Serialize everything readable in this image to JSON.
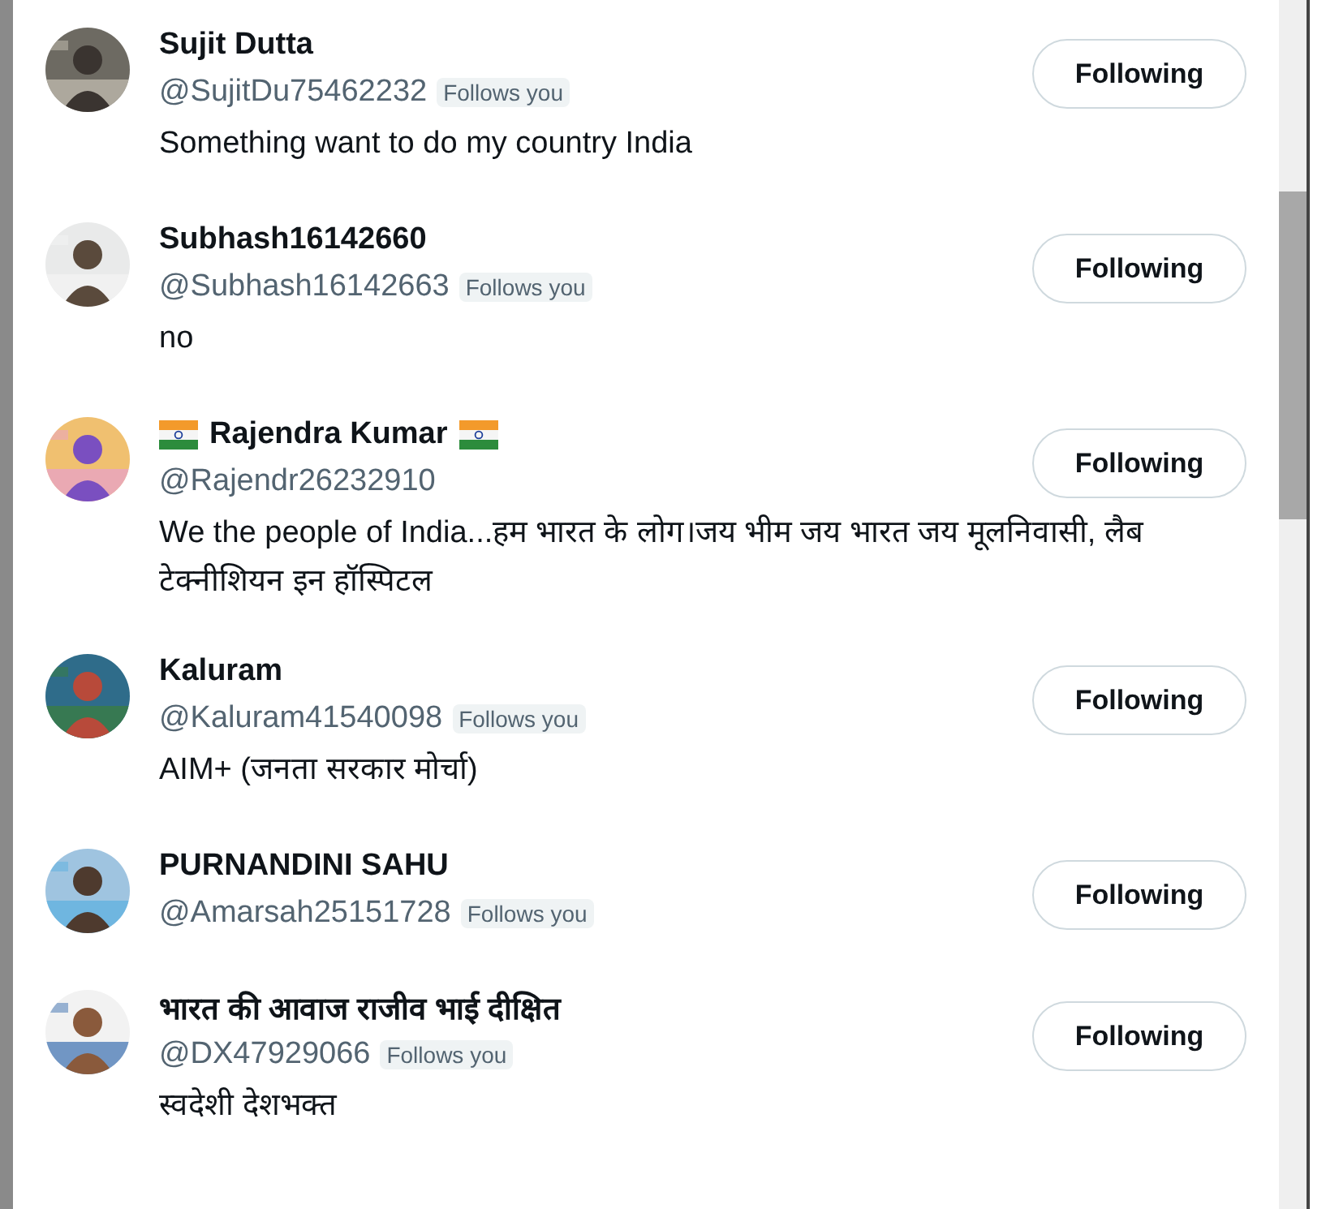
{
  "users": [
    {
      "name": "Sujit Dutta",
      "flag_icons": false,
      "handle": "@SujitDu75462232",
      "badge": "Follows you",
      "bio": "Something want to do my country India",
      "button": "Following"
    },
    {
      "name": "Subhash16142660",
      "flag_icons": false,
      "handle": "@Subhash16142663",
      "badge": "Follows you",
      "bio": "no",
      "button": "Following"
    },
    {
      "name": "Rajendra Kumar",
      "flag_icons": true,
      "handle": "@Rajendr26232910",
      "bio": "We the people of India...हम भारत के लोग।जय भीम जय भारत जय मूलनिवासी, लैब टेक्नीशियन इन हॉस्पिटल",
      "button": "Following"
    },
    {
      "name": "Kaluram",
      "flag_icons": false,
      "handle": "@Kaluram41540098",
      "badge": "Follows you",
      "bio": "AIM+ (जनता सरकार मोर्चा)",
      "button": "Following"
    },
    {
      "name": "PURNANDINI SAHU",
      "flag_icons": false,
      "handle": "@Amarsah25151728",
      "badge": "Follows you",
      "button": "Following"
    },
    {
      "name": "भारत की आवाज राजीव भाई दीक्षित",
      "flag_icons": false,
      "handle": "@DX47929066",
      "badge": "Follows you",
      "bio": "स्वदेशी देशभक्त",
      "button": "Following"
    }
  ]
}
